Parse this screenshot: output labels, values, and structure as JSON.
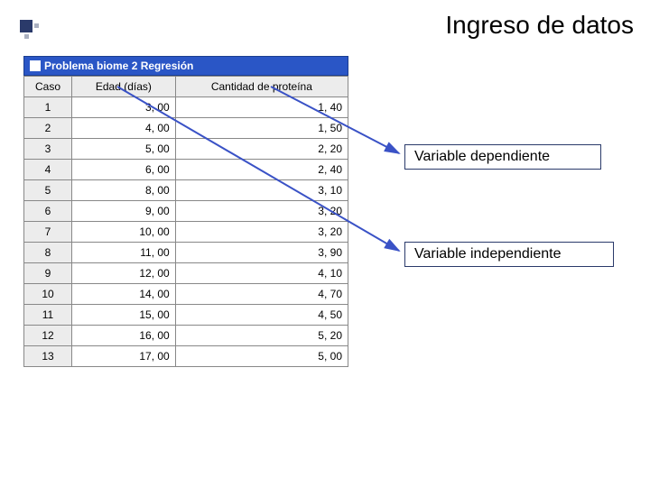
{
  "page": {
    "title": "Ingreso de datos",
    "window_title": "Problema biome 2 Regresión"
  },
  "table": {
    "headers": {
      "caso": "Caso",
      "edad": "Edad (días)",
      "prot": "Cantidad de proteína"
    },
    "rows": [
      {
        "caso": "1",
        "edad": "3, 00",
        "prot": "1, 40"
      },
      {
        "caso": "2",
        "edad": "4, 00",
        "prot": "1, 50"
      },
      {
        "caso": "3",
        "edad": "5, 00",
        "prot": "2, 20"
      },
      {
        "caso": "4",
        "edad": "6, 00",
        "prot": "2, 40"
      },
      {
        "caso": "5",
        "edad": "8, 00",
        "prot": "3, 10"
      },
      {
        "caso": "6",
        "edad": "9, 00",
        "prot": "3, 20"
      },
      {
        "caso": "7",
        "edad": "10, 00",
        "prot": "3, 20"
      },
      {
        "caso": "8",
        "edad": "11, 00",
        "prot": "3, 90"
      },
      {
        "caso": "9",
        "edad": "12, 00",
        "prot": "4, 10"
      },
      {
        "caso": "10",
        "edad": "14, 00",
        "prot": "4, 70"
      },
      {
        "caso": "11",
        "edad": "15, 00",
        "prot": "4, 50"
      },
      {
        "caso": "12",
        "edad": "16, 00",
        "prot": "5, 20"
      },
      {
        "caso": "13",
        "edad": "17, 00",
        "prot": "5, 00"
      }
    ]
  },
  "annotations": {
    "dep": "Variable dependiente",
    "ind": "Variable independiente"
  },
  "chart_data": {
    "type": "table",
    "title": "Problema biome 2 Regresión",
    "columns": [
      "Caso",
      "Edad (días)",
      "Cantidad de proteína"
    ],
    "x_label": "Edad (días)",
    "y_label": "Cantidad de proteína",
    "independent_variable": "Edad (días)",
    "dependent_variable": "Cantidad de proteína",
    "x": [
      3,
      4,
      5,
      6,
      8,
      9,
      10,
      11,
      12,
      14,
      15,
      16,
      17
    ],
    "y": [
      1.4,
      1.5,
      2.2,
      2.4,
      3.1,
      3.2,
      3.2,
      3.9,
      4.1,
      4.7,
      4.5,
      5.2,
      5.0
    ]
  }
}
